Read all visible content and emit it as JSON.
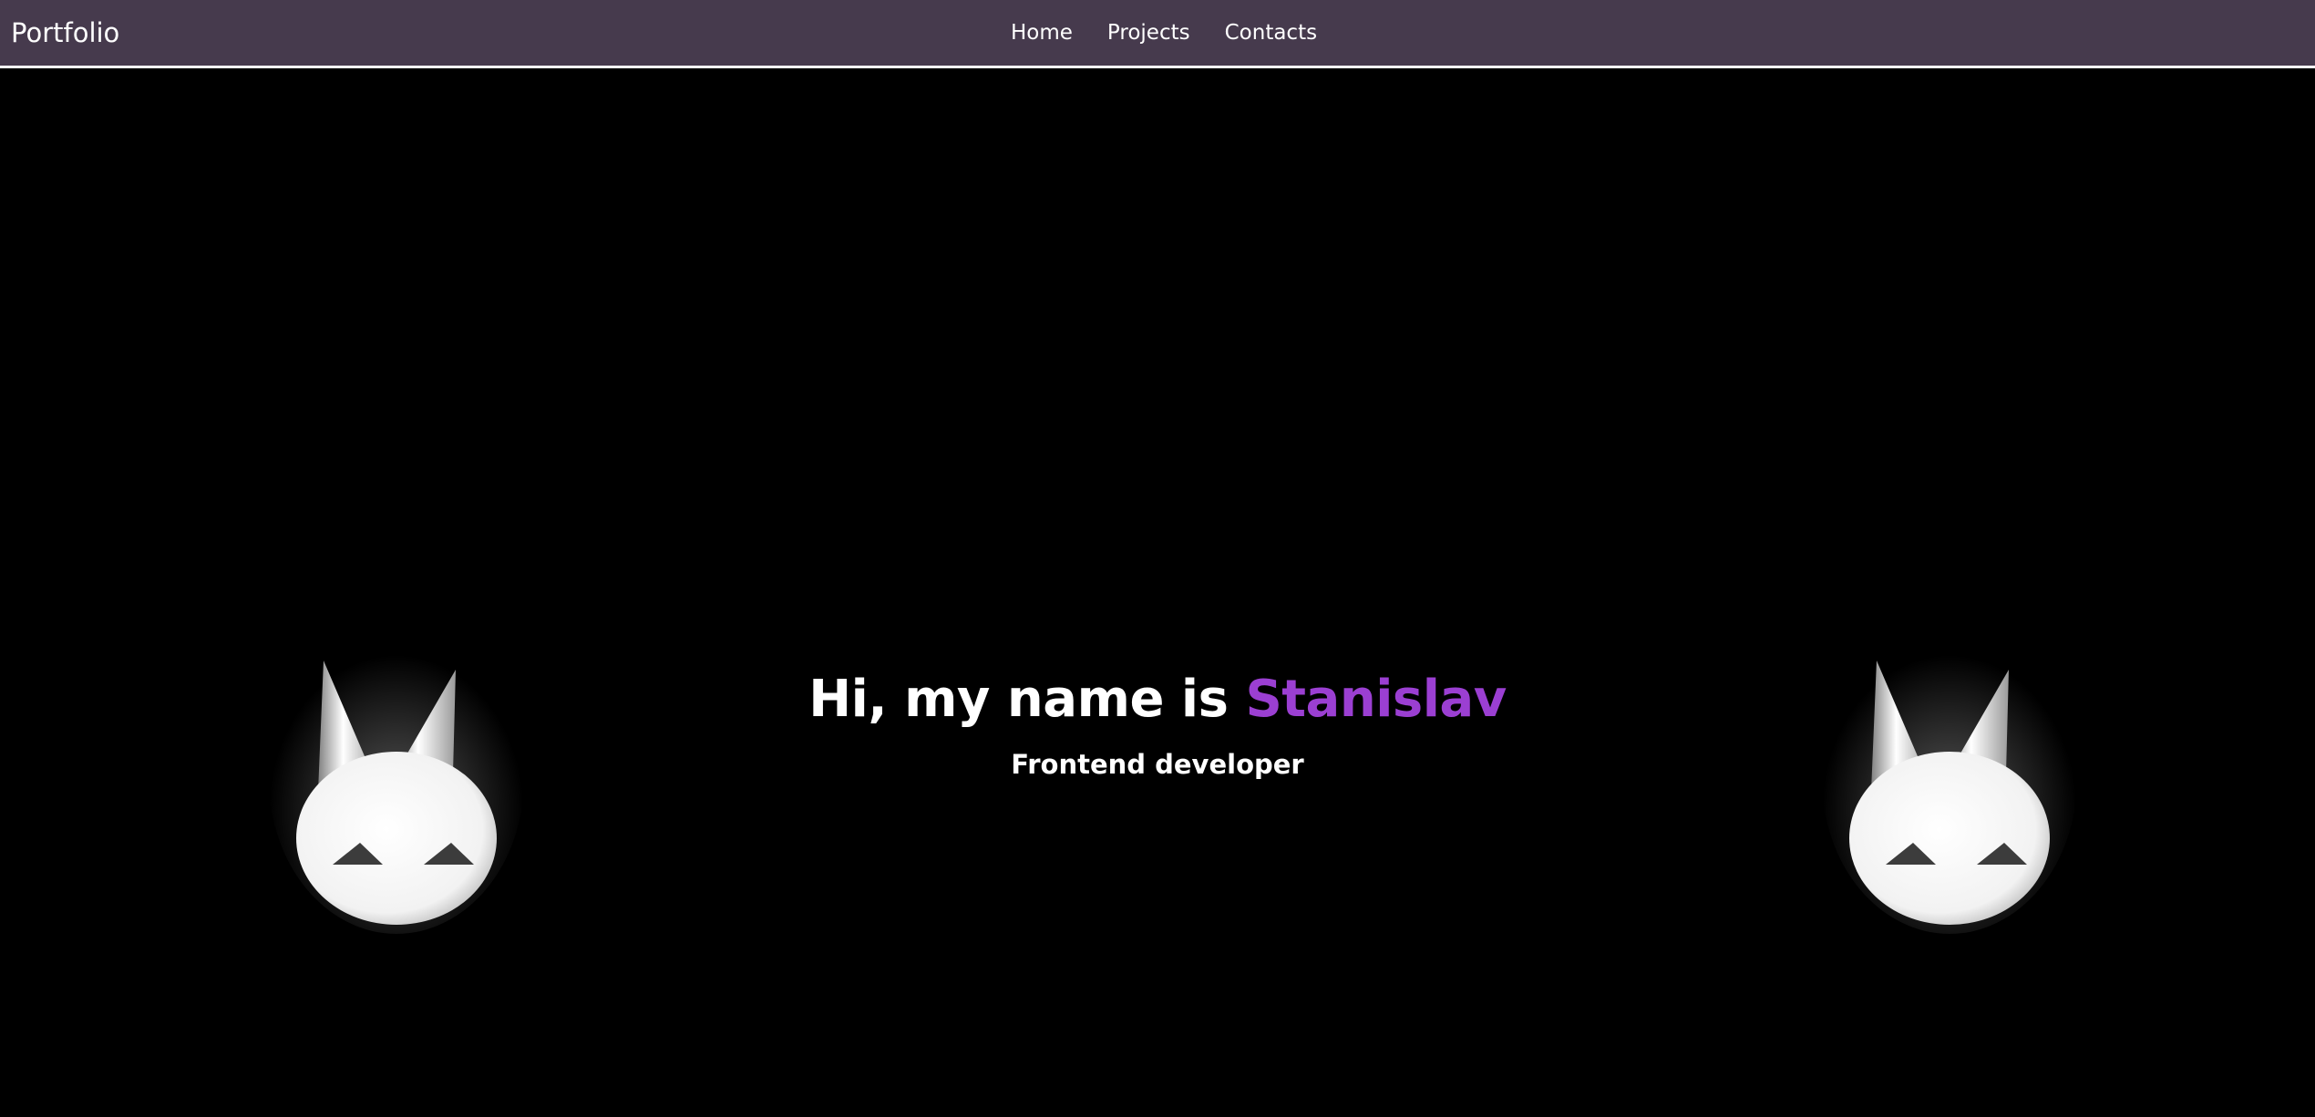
{
  "header": {
    "brand": "Portfolio",
    "nav": [
      {
        "label": "Home"
      },
      {
        "label": "Projects"
      },
      {
        "label": "Contacts"
      }
    ]
  },
  "hero": {
    "greeting_prefix": "Hi, my name is ",
    "name": "Stanislav",
    "subtitle": "Frontend developer"
  },
  "colors": {
    "navbar_bg": "#463a4d",
    "accent": "#9b3fd2",
    "background": "#000000"
  }
}
